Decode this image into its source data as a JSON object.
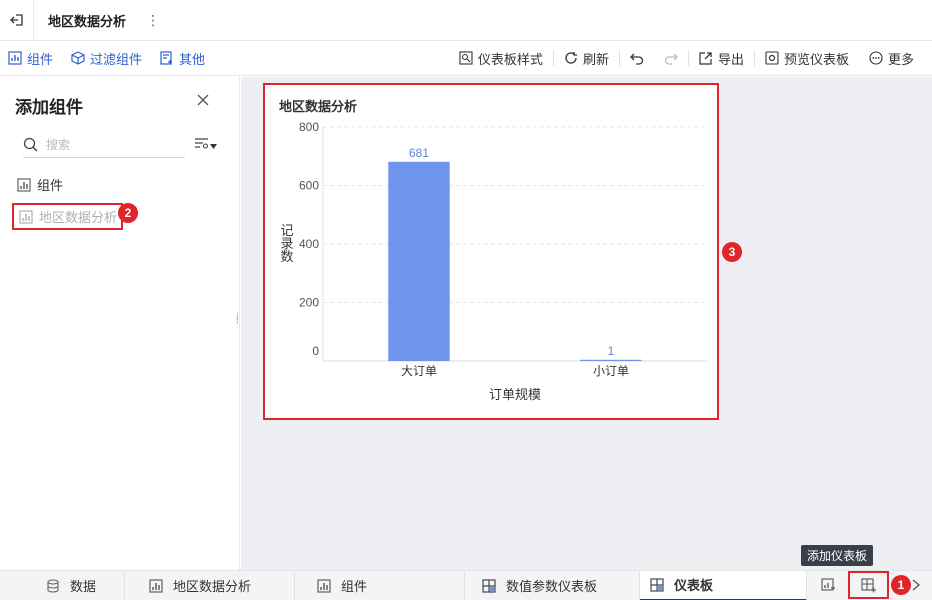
{
  "titlebar": {
    "title": "地区数据分析",
    "more": "⋮"
  },
  "toolbar": {
    "left": [
      {
        "label": "组件",
        "icon": "chart-add-icon"
      },
      {
        "label": "过滤组件",
        "icon": "filter-cube-icon"
      },
      {
        "label": "其他",
        "icon": "other-widgets-icon"
      }
    ],
    "right": {
      "style": "仪表板样式",
      "refresh": "刷新",
      "export": "导出",
      "preview": "预览仪表板",
      "more": "更多"
    }
  },
  "panel": {
    "title": "添加组件",
    "search_placeholder": "搜索",
    "group_label": "组件",
    "chart_label": "地区数据分析"
  },
  "widget": {
    "title": "地区数据分析"
  },
  "chart_data": {
    "type": "bar",
    "title": "地区数据分析",
    "categories": [
      "大订单",
      "小订单"
    ],
    "values": [
      681,
      1
    ],
    "xlabel": "订单规模",
    "ylabel": "记录数",
    "ylim": [
      0,
      800
    ],
    "yticks": [
      0,
      200,
      400,
      600,
      800
    ],
    "grid": true,
    "bar_color": "#6f94ed",
    "label_color": "#5b82dc"
  },
  "badges": {
    "b1": "1",
    "b2": "2",
    "b3": "3"
  },
  "tooltip": "添加仪表板",
  "tabs": [
    {
      "label": "数据",
      "icon": "database-icon"
    },
    {
      "label": "地区数据分析",
      "icon": "bar-chart-icon"
    },
    {
      "label": "组件",
      "icon": "bar-chart-icon"
    },
    {
      "label": "数值参数仪表板",
      "icon": "dashboard-icon"
    },
    {
      "label": "仪表板",
      "icon": "dashboard-icon"
    }
  ],
  "colors": {
    "accent": "#2d5fcf",
    "highlight": "#e0242a",
    "canvas_bg": "#eeeff2"
  }
}
